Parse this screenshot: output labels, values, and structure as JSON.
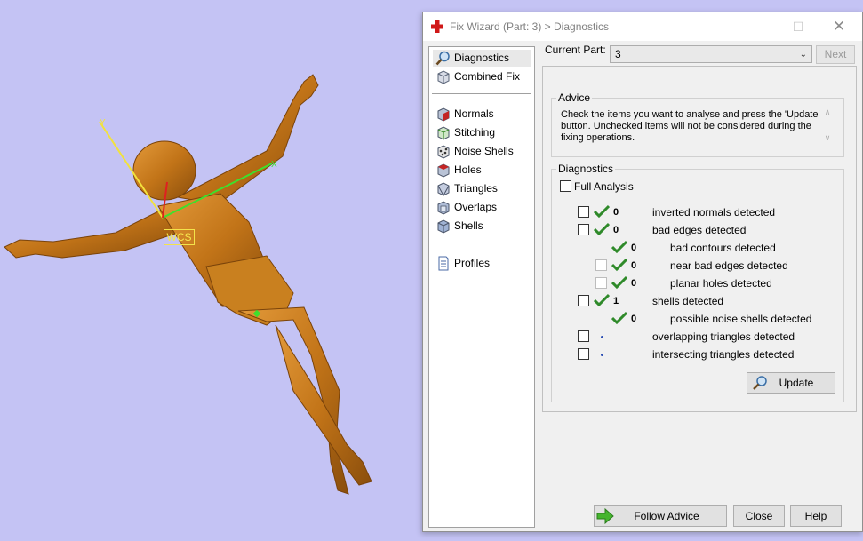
{
  "viewport": {
    "wcs_label": "WCS",
    "axis_y_label": "Y",
    "axis_x_label": "X",
    "background": "#c4c3f4",
    "model_color": "#c87820"
  },
  "dialog": {
    "title": "Fix Wizard (Part: 3) > Diagnostics",
    "window_buttons": {
      "minimize": "—",
      "maximize": "☐",
      "close": "✕"
    },
    "nav": {
      "items": [
        {
          "label": "Diagnostics",
          "icon": "magnifier-icon"
        },
        {
          "label": "Combined Fix",
          "icon": "cube-icon"
        },
        {
          "label": "Normals",
          "icon": "normals-cube-icon"
        },
        {
          "label": "Stitching",
          "icon": "stitching-cube-icon"
        },
        {
          "label": "Noise Shells",
          "icon": "noise-shells-icon"
        },
        {
          "label": "Holes",
          "icon": "holes-cube-icon"
        },
        {
          "label": "Triangles",
          "icon": "triangles-cube-icon"
        },
        {
          "label": "Overlaps",
          "icon": "overlaps-cube-icon"
        },
        {
          "label": "Shells",
          "icon": "shells-cube-icon"
        },
        {
          "label": "Profiles",
          "icon": "document-icon"
        }
      ]
    },
    "current_part_label": "Current Part:",
    "current_part_value": "3",
    "next_label": "Next",
    "advice": {
      "title": "Advice",
      "text": "Check the items you want to analyse and press the 'Update' button. Unchecked items will not be considered during the fixing operations."
    },
    "diagnostics": {
      "title": "Diagnostics",
      "full_analysis_label": "Full Analysis",
      "rows": [
        {
          "label": "inverted normals detected",
          "count": "0"
        },
        {
          "label": "bad edges detected",
          "count": "0"
        },
        {
          "label": "bad contours detected",
          "count": "0"
        },
        {
          "label": "near bad edges detected",
          "count": "0"
        },
        {
          "label": "planar holes detected",
          "count": "0"
        },
        {
          "label": "shells detected",
          "count": "1"
        },
        {
          "label": "possible noise shells detected",
          "count": "0"
        },
        {
          "label": "overlapping triangles detected",
          "count": ""
        },
        {
          "label": "intersecting triangles detected",
          "count": ""
        }
      ],
      "update_label": "Update"
    },
    "footer": {
      "follow_advice_label": "Follow Advice",
      "close_label": "Close",
      "help_label": "Help"
    }
  }
}
